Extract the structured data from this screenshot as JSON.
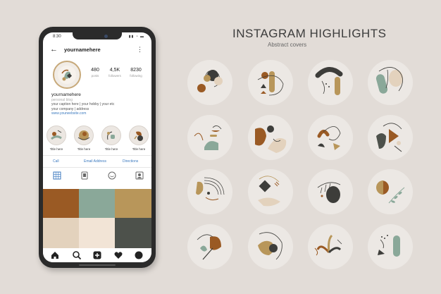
{
  "heading": {
    "title": "INSTAGRAM HIGHLIGHTS",
    "subtitle": "Abstract covers"
  },
  "phone": {
    "status_time": "8:30",
    "username": "yournamehere",
    "stats": [
      {
        "value": "480",
        "label": "posts"
      },
      {
        "value": "4,5K",
        "label": "followers"
      },
      {
        "value": "8230",
        "label": "following"
      }
    ],
    "bio": {
      "name": "yournamehere",
      "category": "personal blog",
      "line1": "your caption here  | your hobby | your etc",
      "line2": "your company | address",
      "link": "www.yourwebsite.com"
    },
    "highlights": [
      "Title here",
      "Title here",
      "Title here",
      "Title here"
    ],
    "actions": [
      "Call",
      "Email Address",
      "Directions"
    ],
    "tab_icons": [
      "grid-icon",
      "reels-icon",
      "smile-icon",
      "tagged-icon"
    ],
    "grid_colors": [
      "#9a5a24",
      "#8aa899",
      "#b8965a",
      "#e3d2bd",
      "#f2e4d6",
      "#4d514b"
    ],
    "nav_icons": [
      "home-icon",
      "search-icon",
      "add-icon",
      "heart-icon",
      "profile-icon"
    ]
  },
  "colors": {
    "rust": "#9a5a24",
    "sage": "#8aa899",
    "ochre": "#b8965a",
    "beige": "#e3d2bd",
    "charcoal": "#3d3d3a",
    "background": "#e2dcd7"
  }
}
